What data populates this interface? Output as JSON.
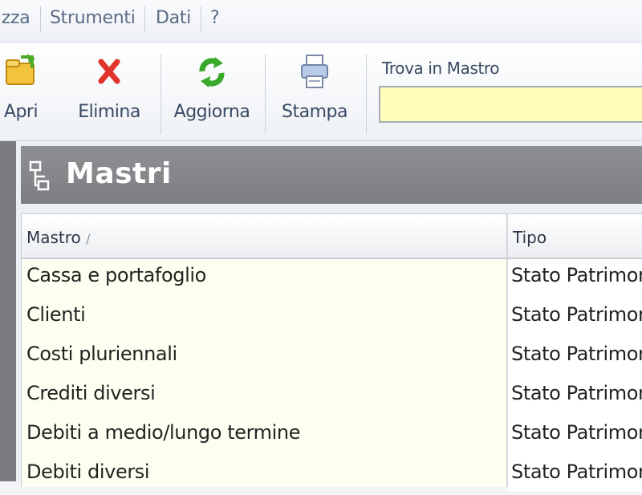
{
  "menubar": {
    "items": [
      "izza",
      "Strumenti",
      "Dati",
      "?"
    ]
  },
  "toolbar": {
    "buttons": [
      {
        "label": "Apri",
        "icon": "open-icon"
      },
      {
        "label": "Elimina",
        "icon": "delete-icon"
      },
      {
        "label": "Aggiorna",
        "icon": "refresh-icon"
      },
      {
        "label": "Stampa",
        "icon": "print-icon"
      }
    ],
    "find": {
      "label": "Trova in Mastro",
      "value": ""
    }
  },
  "panel": {
    "title": "Mastri",
    "icon": "hierarchy-icon"
  },
  "grid": {
    "columns": [
      "Mastro",
      "Tipo"
    ],
    "rows": [
      {
        "name": "Cassa e portafoglio",
        "type": "Stato Patrimoni"
      },
      {
        "name": "Clienti",
        "type": "Stato Patrimoni"
      },
      {
        "name": "Costi pluriennali",
        "type": "Stato Patrimoni"
      },
      {
        "name": "Crediti diversi",
        "type": "Stato Patrimoni"
      },
      {
        "name": "Debiti a medio/lungo termine",
        "type": "Stato Patrimoni"
      },
      {
        "name": "Debiti diversi",
        "type": "Stato Patrimoni"
      }
    ]
  },
  "colors": {
    "find_bg": "#fffdb8",
    "panel_header": "#808286",
    "grid_bg": "#fffff1"
  }
}
